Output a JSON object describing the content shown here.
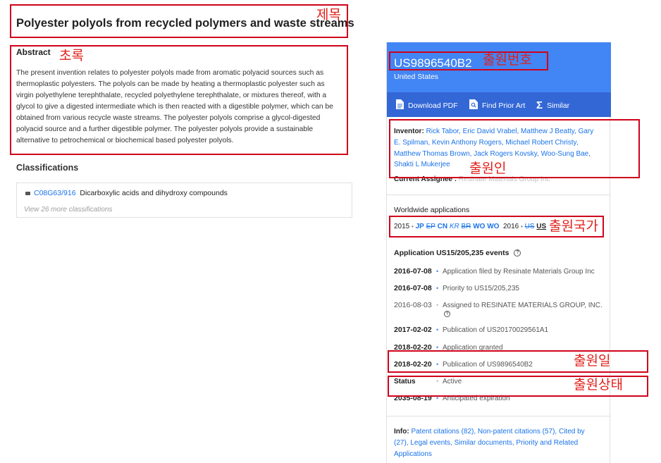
{
  "title": "Polyester polyols from recycled polymers and waste streams",
  "abstract": {
    "heading": "Abstract",
    "lines": [
      "The present invention relates to polyester polyols made from aromatic polyacid sources such as",
      "thermoplastic polyesters. The polyols can be made by heating a thermoplastic polyester such as",
      "virgin polyethylene terephthalate, recycled polyethylene terephthalate, or mixtures thereof, with a",
      "glycol to give a digested intermediate which is then reacted with a digestible polymer, which can be",
      "obtained from various recycle waste streams. The polyester polyols comprise a glycol-digested",
      "polyacid source and a further digestible polymer. The polyester polyols provide a sustainable",
      "alternative to petrochemical or biochemical based polyester polyols."
    ]
  },
  "classifications": {
    "heading": "Classifications",
    "code": "C08G63/916",
    "description": "Dicarboxylic acids and dihydroxy compounds",
    "more": "View 26 more classifications"
  },
  "panel": {
    "pub_number": "US9896540B2",
    "country": "United States",
    "actions": {
      "pdf": "Download PDF",
      "prior_art": "Find Prior Art",
      "similar": "Similar"
    },
    "inventor_label": "Inventor:",
    "inventors": [
      "Rick Tabor",
      "Eric David Vrabel",
      "Matthew J Beatty",
      "Gary E. Spilman",
      "Kevin Anthony Rogers",
      "Michael Robert Christy",
      "Matthew Thomas Brown",
      "Jack Rogers Kovsky",
      "Woo-Sung Bae",
      "Shakti L Mukerjee"
    ],
    "inventor_lines": [
      "Rick Tabor, Eric David Vrabel, Matthew J Beatty, Gary",
      "E. Spilman, Kevin Anthony Rogers, Michael Robert Christy,",
      "Matthew Thomas Brown, Jack Rogers Kovsky, Woo-Sung Bae,",
      "Shakti L Mukerjee"
    ],
    "assignee_label": "Current Assignee :",
    "assignee": "Resinate Materials Group Inc",
    "worldwide_heading": "Worldwide applications",
    "ww_2015_year": "2015",
    "ww_2015": [
      "JP",
      "EP",
      "CN",
      "KR",
      "BR",
      "WO",
      "WO"
    ],
    "ww_2016_year": "2016",
    "ww_2016": [
      "US",
      "US"
    ],
    "events_heading": "Application US15/205,235 events",
    "events": [
      {
        "date": "2016-07-08",
        "text": "Application filed by Resinate Materials Group Inc"
      },
      {
        "date": "2016-07-08",
        "text": "Priority to US15/205,235"
      },
      {
        "date": "2016-08-03",
        "text": "Assigned to RESINATE MATERIALS GROUP, INC."
      },
      {
        "date": "2017-02-02",
        "text": "Publication of US20170029561A1"
      },
      {
        "date": "2018-02-20",
        "text": "Application granted"
      },
      {
        "date": "2018-02-20",
        "text": "Publication of US9896540B2"
      },
      {
        "date": "Status",
        "text": "Active"
      },
      {
        "date": "2035-08-19",
        "text": "Anticipated expiration"
      }
    ],
    "info_label": "Info:",
    "info_lines": [
      "Patent citations (82), Non-patent citations (57), Cited by",
      "(27), Legal events, Similar documents, Priority and Related",
      "Applications"
    ]
  },
  "annotations": {
    "title": "제목",
    "abstract": "초록",
    "pub_number": "출원번호",
    "applicant": "출원인",
    "countries": "출원국가",
    "date": "출원일",
    "status": "출원상태"
  },
  "colors": {
    "annotation": "#e0201a",
    "link": "#1a73e8",
    "header": "#4285f4",
    "actions_bar": "#3367d6"
  }
}
